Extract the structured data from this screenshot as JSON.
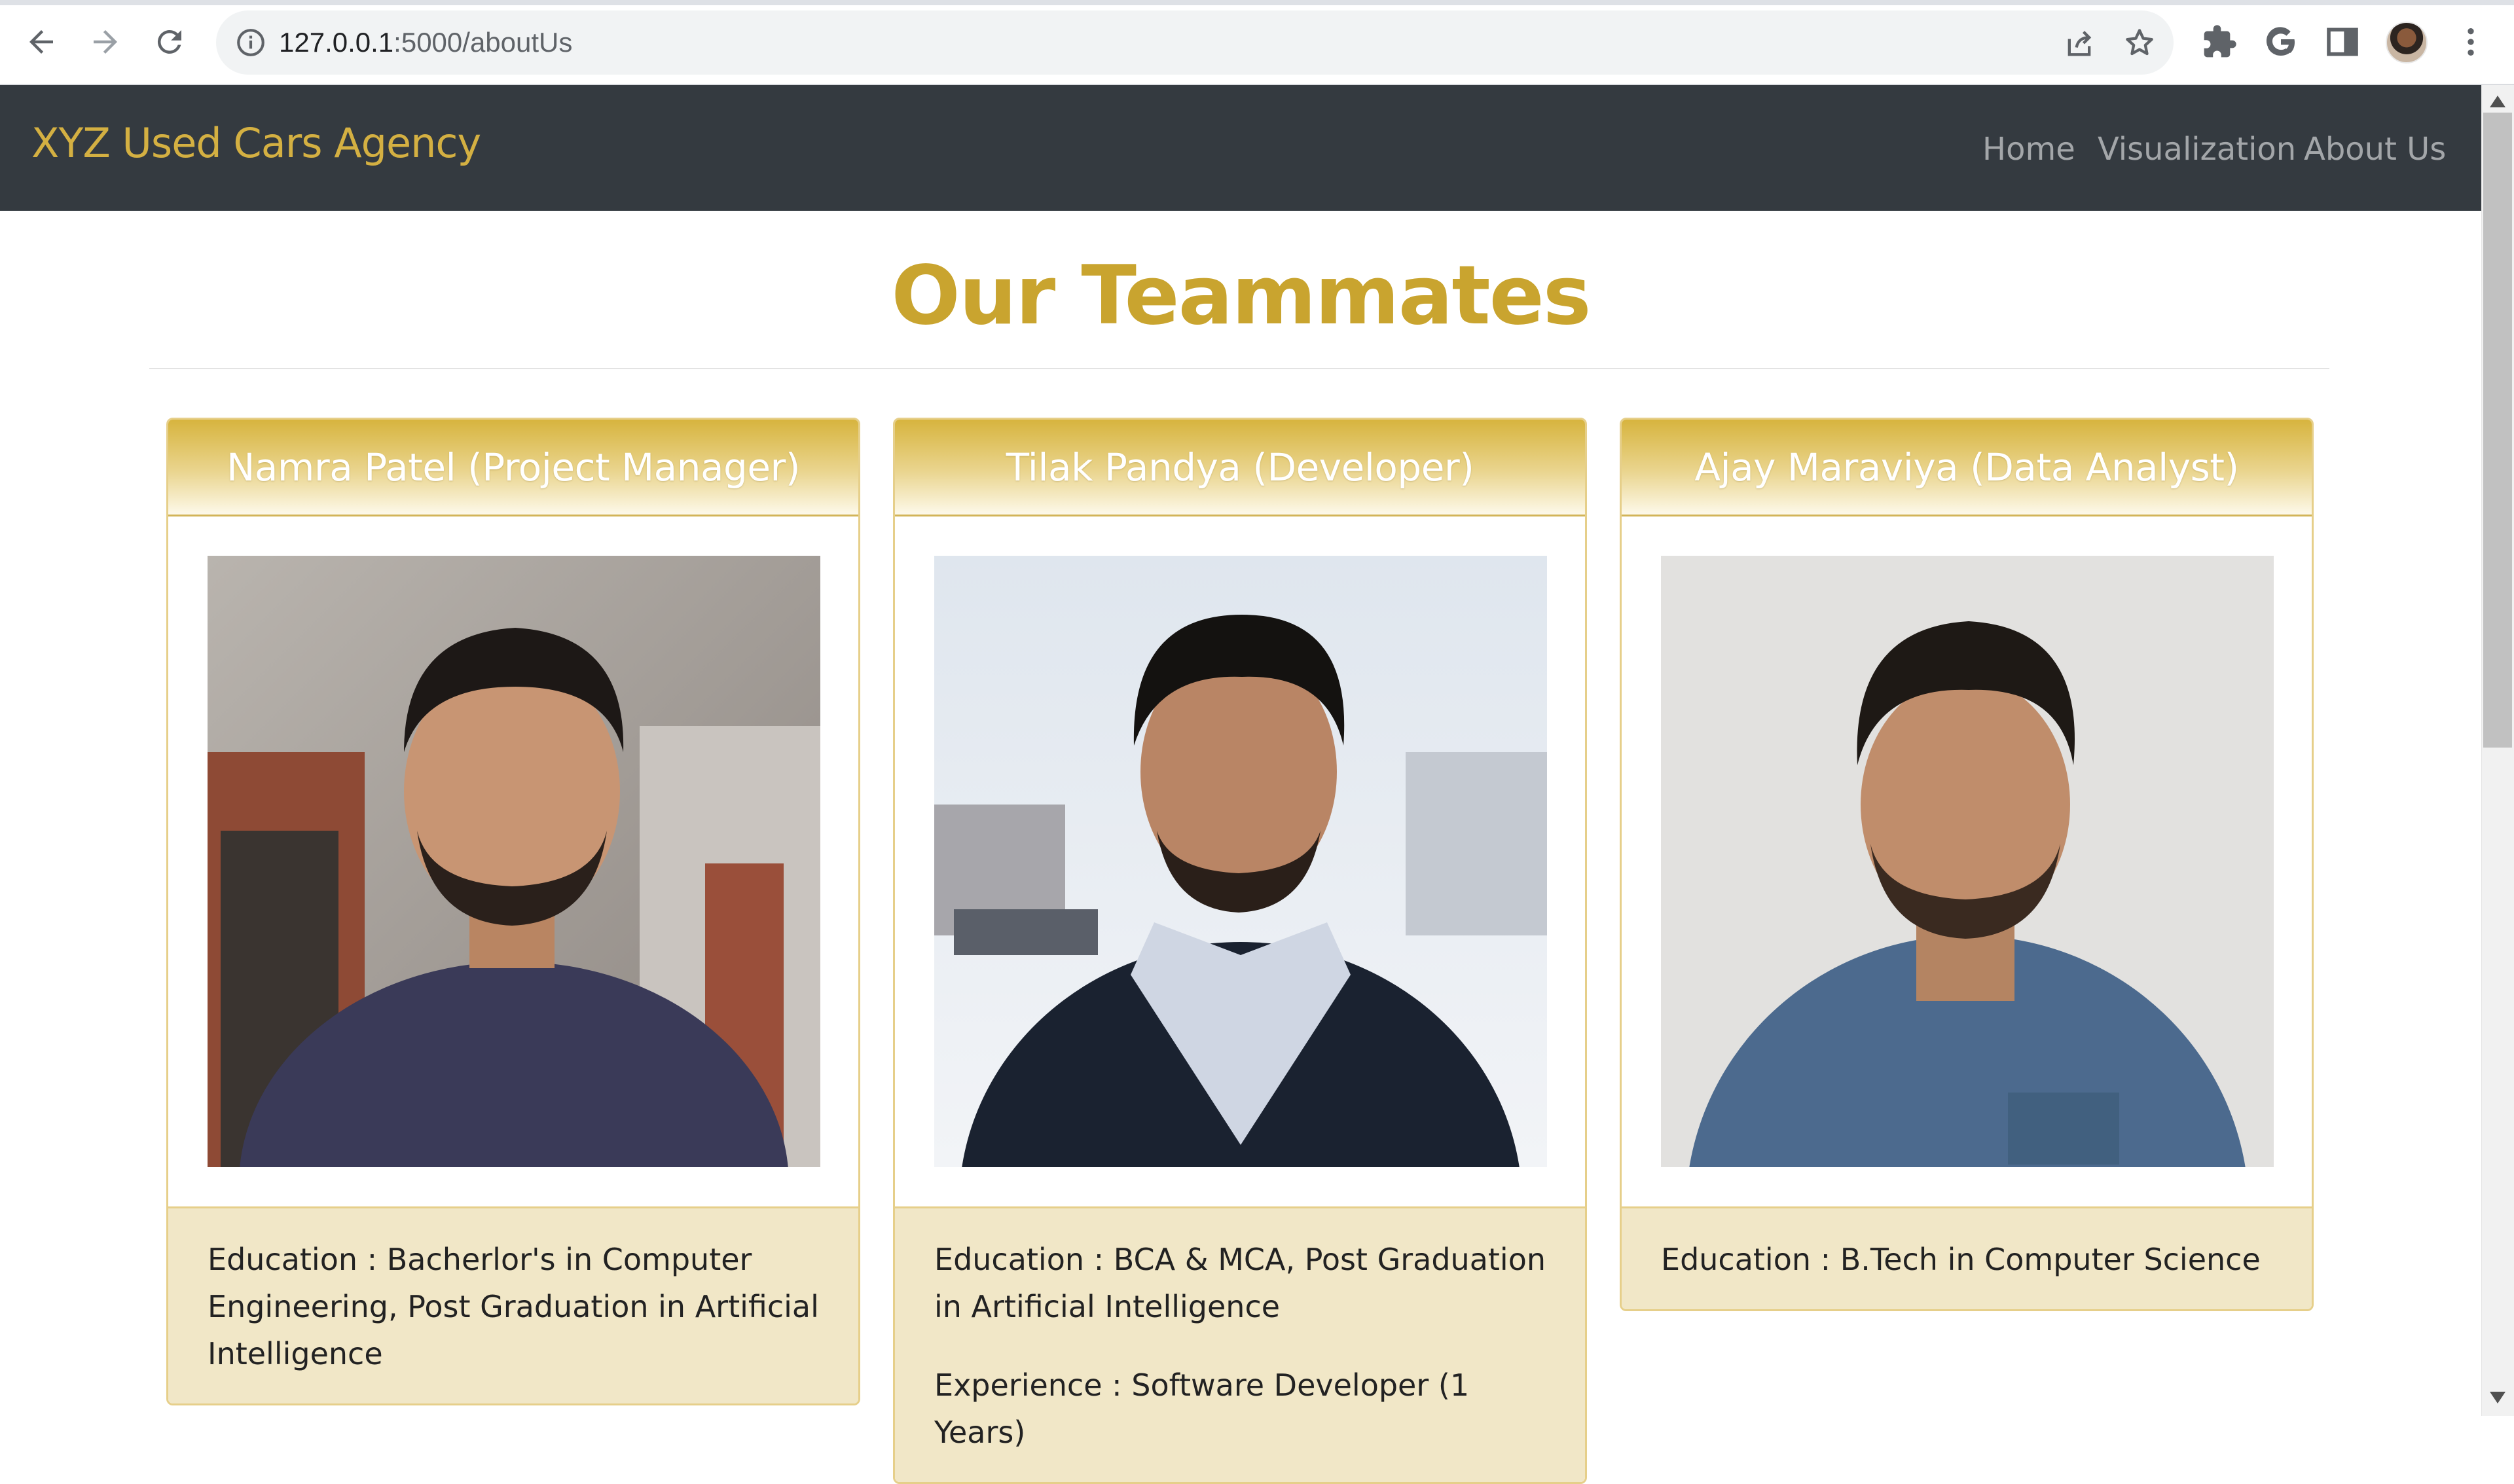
{
  "browser": {
    "url_host": "127.0.0.1",
    "url_path": ":5000/aboutUs"
  },
  "navbar": {
    "brand": "XYZ Used Cars Agency",
    "links": [
      {
        "label": "Home"
      },
      {
        "label": "Visualization"
      },
      {
        "label": "About Us"
      }
    ]
  },
  "page": {
    "title": "Our Teammates"
  },
  "team": [
    {
      "name": "Namra Patel (Project Manager)",
      "education": "Education : Bacherlor's in Computer Engineering, Post Graduation in Artificial Intelligence",
      "experience": ""
    },
    {
      "name": "Tilak Pandya (Developer)",
      "education": "Education : BCA & MCA, Post Graduation in Artificial Intelligence",
      "experience": "Experience : Software Developer (1 Years)"
    },
    {
      "name": "Ajay Maraviya (Data Analyst)",
      "education": "Education : B.Tech in Computer Science",
      "experience": ""
    }
  ],
  "colors": {
    "navbar_bg": "#343a40",
    "brand_gold": "#d4b042",
    "title_gold": "#c9a42f",
    "card_footer_bg": "#f1e7c7"
  },
  "icons": {
    "back": "back-arrow-icon",
    "forward": "forward-arrow-icon",
    "reload": "reload-icon",
    "site_info": "info-icon",
    "share": "share-icon",
    "bookmark": "star-icon",
    "extensions": "puzzle-icon",
    "google": "google-icon",
    "side_panel": "side-panel-icon",
    "menu": "kebab-menu-icon"
  }
}
